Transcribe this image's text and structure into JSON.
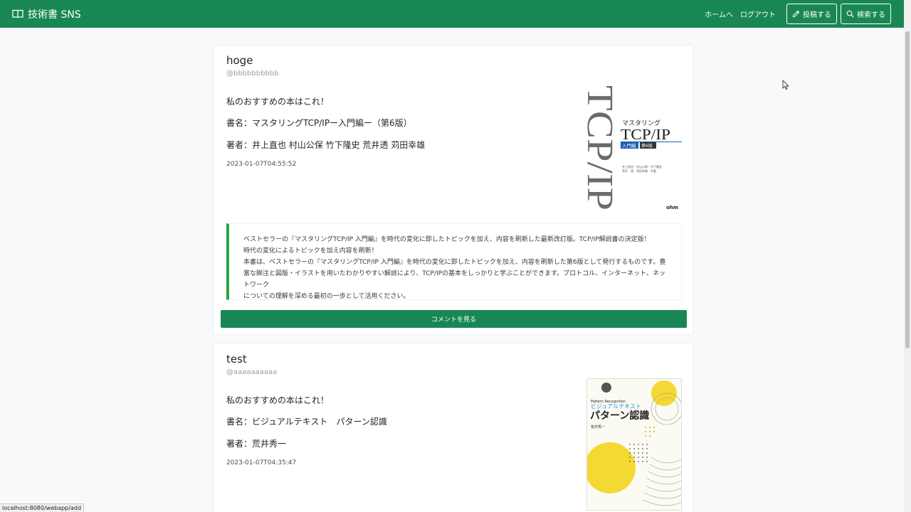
{
  "app": {
    "title": "技術書 SNS"
  },
  "nav": {
    "home": "ホームへ",
    "logout": "ログアウト",
    "post": "投稿する",
    "search": "検索する"
  },
  "posts": [
    {
      "name": "hoge",
      "handle": "@bbbbbbbbbb",
      "intro": "私のおすすめの本はこれ！",
      "title_line": "書名：マスタリングTCP/IPー入門編ー（第6版）",
      "author_line": "著者：井上直也 村山公保 竹下隆史 荒井透 苅田幸雄",
      "timestamp": "2023-01-07T04:55:52",
      "cover": {
        "big": "TCP/IP",
        "series": "マスタリング",
        "title": "TCP/IP",
        "sub": "入門編",
        "edition": "第6版",
        "credit1": "井上直也・村山公保・竹下隆史",
        "credit2": "荒井　透・苅田幸雄　共著",
        "publisher": "ohm"
      },
      "description": [
        "ベストセラーの『マスタリングTCP/IP 入門編』を時代の変化に即したトピックを加え、内容を刷新した最新改訂版。TCP/IP解説書の決定版！",
        "時代の変化によるトピックを加え内容を刷新！",
        "本書は、ベストセラーの『マスタリングTCP/IP 入門編』を時代の変化に即したトピックを加え、内容を刷新した第6版として発行するものです。豊",
        "富な脚注と図版・イラストを用いたわかりやすい解説により、TCP/IPの基本をしっかりと学ぶことができます。プロトコル、インターネット、ネットワーク",
        "についての理解を深める最初の一歩として活用ください。"
      ],
      "comment_button": "コメントを見る"
    },
    {
      "name": "test",
      "handle": "@aaaaaaaaaa",
      "intro": "私のおすすめの本はこれ！",
      "title_line": "書名：ビジュアルテキスト　パターン認識",
      "author_line": "著者：荒井秀一",
      "timestamp": "2023-01-07T04:35:47",
      "cover": {
        "en": "Pattern Recognition",
        "series": "ビジュアルテキスト",
        "title": "パターン認識",
        "author": "荒井秀一"
      }
    }
  ],
  "status_url": "localhost:8080/webapp/add",
  "colors": {
    "brand": "#198754",
    "accent_border": "#28a745",
    "cover_yellow": "#f5d933"
  },
  "icons": [
    "book-icon",
    "pencil-icon",
    "search-icon",
    "mouse-pointer-icon"
  ]
}
